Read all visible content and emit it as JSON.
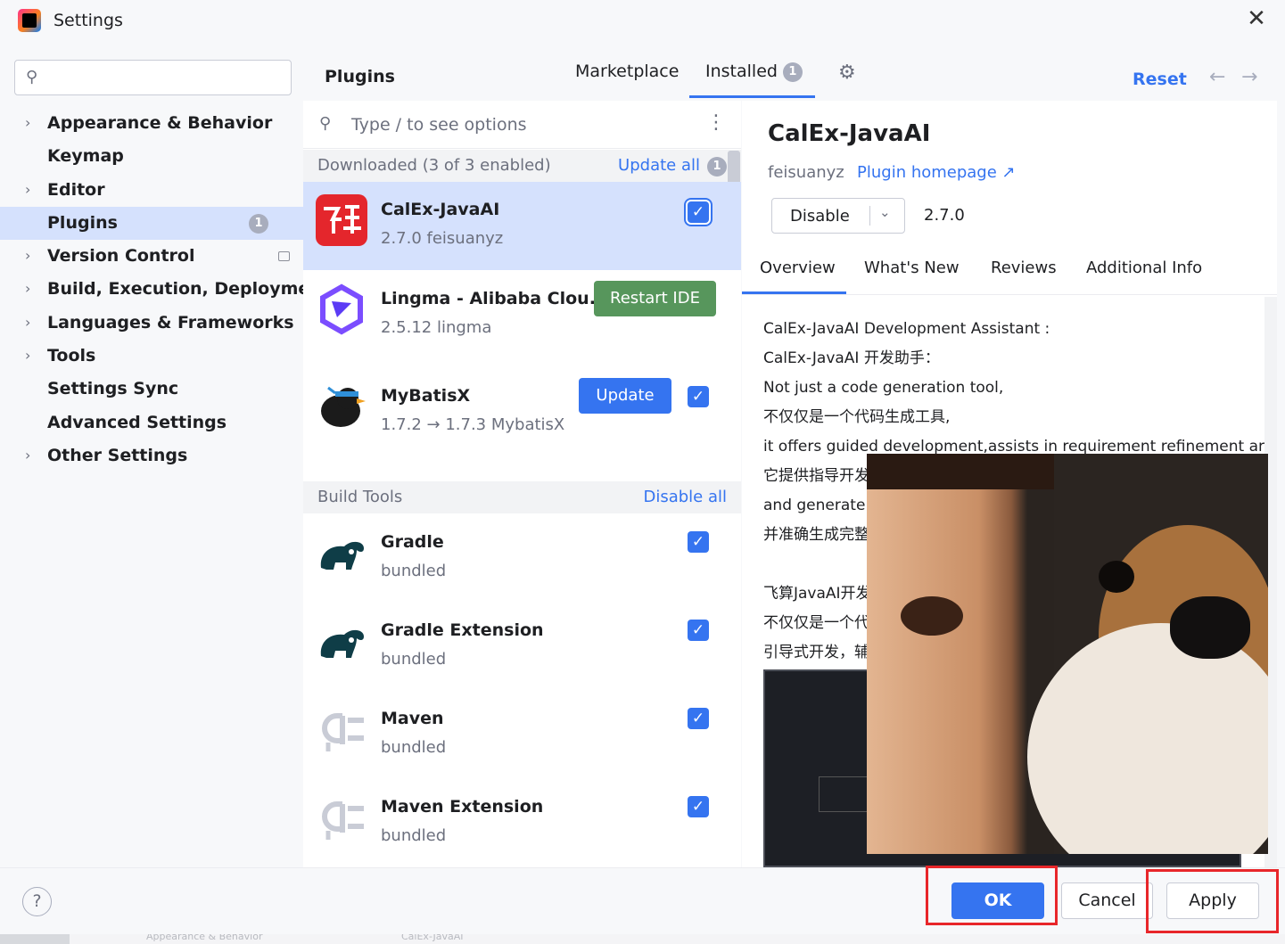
{
  "window": {
    "title": "Settings"
  },
  "sidebar": {
    "search_placeholder": "",
    "items": [
      {
        "label": "Appearance & Behavior",
        "expandable": true
      },
      {
        "label": "Keymap",
        "expandable": false
      },
      {
        "label": "Editor",
        "expandable": true
      },
      {
        "label": "Plugins",
        "expandable": false,
        "selected": true,
        "badge": "1"
      },
      {
        "label": "Version Control",
        "expandable": true
      },
      {
        "label": "Build, Execution, Deployment",
        "expandable": true
      },
      {
        "label": "Languages & Frameworks",
        "expandable": true
      },
      {
        "label": "Tools",
        "expandable": true
      },
      {
        "label": "Settings Sync",
        "expandable": false
      },
      {
        "label": "Advanced Settings",
        "expandable": false
      },
      {
        "label": "Other Settings",
        "expandable": true
      }
    ]
  },
  "header": {
    "title": "Plugins",
    "tabs": [
      {
        "label": "Marketplace"
      },
      {
        "label": "Installed",
        "badge": "1",
        "active": true
      }
    ],
    "reset_label": "Reset"
  },
  "plugin_list": {
    "search_placeholder": "Type / to see options",
    "downloaded_group": {
      "title": "Downloaded (3 of 3 enabled)",
      "action": "Update all",
      "badge": "1"
    },
    "downloaded": [
      {
        "name": "CalEx-JavaAI",
        "meta": "2.7.0  feisuanyz",
        "enabled": true,
        "selected": true
      },
      {
        "name": "Lingma - Alibaba Clou...",
        "meta": "2.5.12  lingma",
        "action": "Restart IDE"
      },
      {
        "name": "MyBatisX",
        "meta": "1.7.2 → 1.7.3  MybatisX",
        "action": "Update",
        "enabled": true
      }
    ],
    "build_group": {
      "title": "Build Tools",
      "action": "Disable all"
    },
    "build": [
      {
        "name": "Gradle",
        "meta": "bundled",
        "enabled": true
      },
      {
        "name": "Gradle Extension",
        "meta": "bundled",
        "enabled": true
      },
      {
        "name": "Maven",
        "meta": "bundled",
        "enabled": true
      },
      {
        "name": "Maven Extension",
        "meta": "bundled",
        "enabled": true
      }
    ]
  },
  "details": {
    "title": "CalEx-JavaAI",
    "vendor": "feisuanyz",
    "homepage": "Plugin homepage ↗",
    "disable_label": "Disable",
    "version": "2.7.0",
    "tabs": [
      "Overview",
      "What's New",
      "Reviews",
      "Additional Info"
    ],
    "description": [
      "CalEx-JavaAI Development Assistant :",
      "CalEx-JavaAI 开发助手：",
      "Not just a code generation tool,",
      "不仅仅是一个代码生成工具,",
      "it offers guided development,assists in requirement refinement ar",
      "它提供指导开发",
      "and generate",
      "并准确生成完整",
      "",
      "飞算JavaAI开发",
      "不仅仅是一个代",
      "引导式开发，辅"
    ]
  },
  "footer": {
    "ok_label": "OK",
    "cancel_label": "Cancel",
    "apply_label": "Apply",
    "help_label": "?"
  },
  "colors": {
    "accent": "#3574f0",
    "selection": "#d5e1fd",
    "restart_green": "#57965c",
    "highlight_red": "#e8262a"
  },
  "icons": {
    "calex": "calex-logo-icon",
    "lingma": "lingma-logo-icon",
    "mybatisx": "mybatisx-bird-icon",
    "gradle": "gradle-elephant-icon",
    "maven": "plug-icon"
  },
  "ghost_strip": [
    "Appearance & Behavior",
    "CalEx-JavaAI"
  ]
}
